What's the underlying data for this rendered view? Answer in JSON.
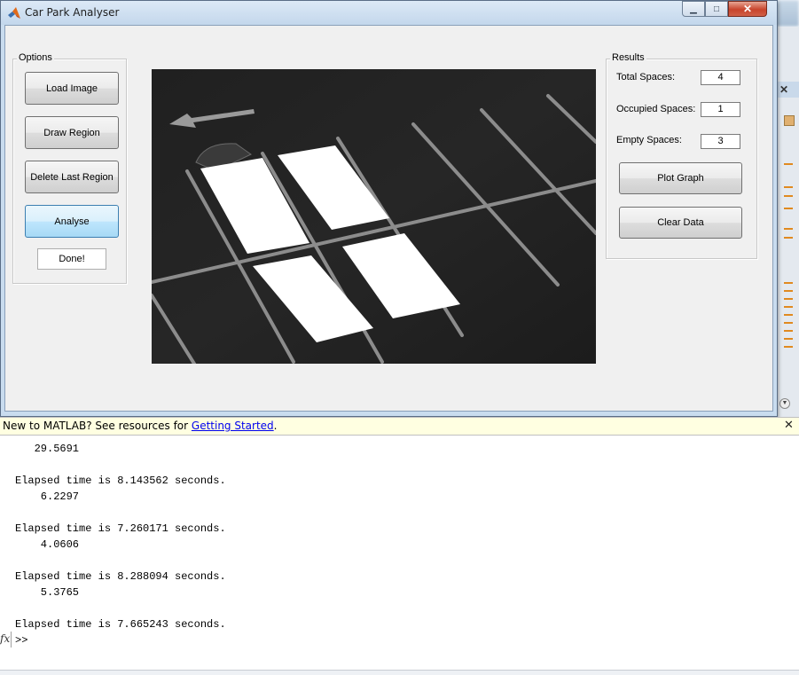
{
  "window": {
    "title": "Car Park Analyser",
    "controls": {
      "minimize": "▁",
      "maximize": "□",
      "close": "✕"
    }
  },
  "options": {
    "title": "Options",
    "load_image": "Load Image",
    "draw_region": "Draw Region",
    "delete_last_region": "Delete Last Region",
    "analyse": "Analyse",
    "done": "Done!"
  },
  "results": {
    "title": "Results",
    "total_label": "Total Spaces:",
    "total_value": "4",
    "occupied_label": "Occupied Spaces:",
    "occupied_value": "1",
    "empty_label": "Empty Spaces:",
    "empty_value": "3",
    "plot_graph": "Plot Graph",
    "clear_data": "Clear Data"
  },
  "command_window": {
    "help_prefix": "New to MATLAB? See resources for ",
    "help_link": "Getting Started",
    "help_suffix": ".",
    "lines": [
      "   29.5691",
      "",
      "Elapsed time is 8.143562 seconds.",
      "    6.2297",
      "",
      "Elapsed time is 7.260171 seconds.",
      "    4.0606",
      "",
      "Elapsed time is 8.288094 seconds.",
      "    5.3765",
      "",
      "Elapsed time is 7.665243 seconds."
    ],
    "prompt": ">>",
    "fx": "fx"
  },
  "icons": {
    "app": "matlab-logo-icon",
    "help_close": "close-icon",
    "fx": "function-browser-icon"
  },
  "colors": {
    "titlebar": "#c3d7ec",
    "analyse_active": "#bee6fd",
    "help_bar": "#ffffe1",
    "link": "#0000ee"
  }
}
